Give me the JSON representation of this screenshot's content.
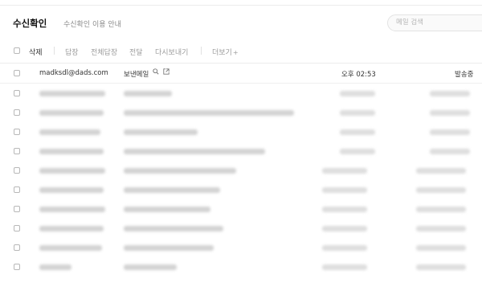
{
  "header": {
    "title": "수신확인",
    "subtitle": "수신확인 이용 안내",
    "search_placeholder": "메일 검색"
  },
  "toolbar": {
    "delete": "삭제",
    "reply": "답장",
    "reply_all": "전체답장",
    "forward": "전달",
    "resend": "다시보내기",
    "more": "더보기",
    "more_icon": "plus-icon"
  },
  "first_row": {
    "sender": "madksdl@dads.com",
    "subject": "보낸메일",
    "icons": [
      "search-icon",
      "external-link-icon"
    ],
    "time": "오후 02:53",
    "status": "발송중"
  }
}
